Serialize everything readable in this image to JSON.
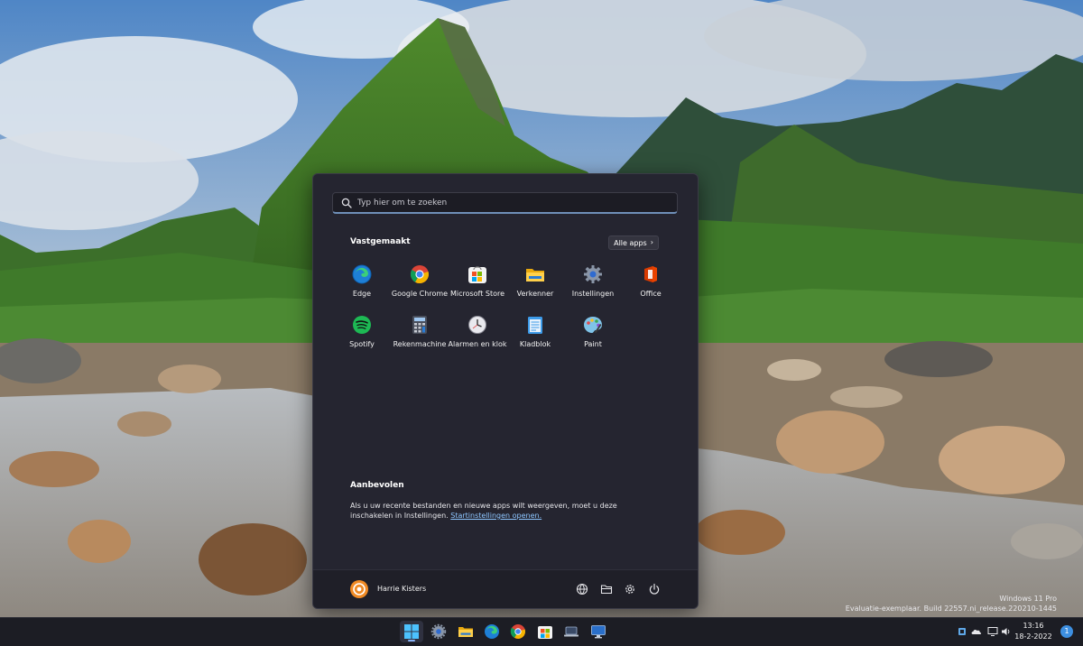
{
  "search": {
    "placeholder": "Typ hier om te zoeken"
  },
  "pinned": {
    "title": "Vastgemaakt",
    "all_apps_label": "Alle apps",
    "apps": [
      {
        "label": "Edge",
        "icon": "edge-icon"
      },
      {
        "label": "Google Chrome",
        "icon": "chrome-icon"
      },
      {
        "label": "Microsoft Store",
        "icon": "store-icon"
      },
      {
        "label": "Verkenner",
        "icon": "folder-icon"
      },
      {
        "label": "Instellingen",
        "icon": "gear-icon"
      },
      {
        "label": "Office",
        "icon": "office-icon"
      },
      {
        "label": "Spotify",
        "icon": "spotify-icon"
      },
      {
        "label": "Rekenmachine",
        "icon": "calculator-icon"
      },
      {
        "label": "Alarmen en klok",
        "icon": "clock-icon"
      },
      {
        "label": "Kladblok",
        "icon": "notepad-icon"
      },
      {
        "label": "Paint",
        "icon": "paint-icon"
      }
    ]
  },
  "recommended": {
    "title": "Aanbevolen",
    "text": "Als u uw recente bestanden en nieuwe apps wilt weergeven, moet u deze inschakelen in Instellingen.",
    "link": "Startinstellingen openen."
  },
  "user": {
    "name": "Harrie Kisters"
  },
  "footer_icons": [
    "network-icon",
    "file-explorer-icon",
    "settings-icon",
    "power-icon"
  ],
  "watermark": {
    "line1": "Windows 11 Pro",
    "line2": "Evaluatie-exemplaar. Build 22557.ni_release.220210-1445"
  },
  "taskbar": {
    "apps": [
      "windows-start-icon",
      "settings-icon",
      "file-explorer-icon",
      "edge-icon",
      "chrome-icon",
      "store-icon",
      "laptop-icon",
      "remote-desktop-icon"
    ],
    "clock_time": "13:16",
    "clock_date": "18-2-2022",
    "notification_count": "1"
  },
  "colors": {
    "start_bg": "#252530",
    "taskbar_bg": "#1c1d24",
    "link": "#8ec6ff",
    "accent": "#3d8fe0"
  }
}
